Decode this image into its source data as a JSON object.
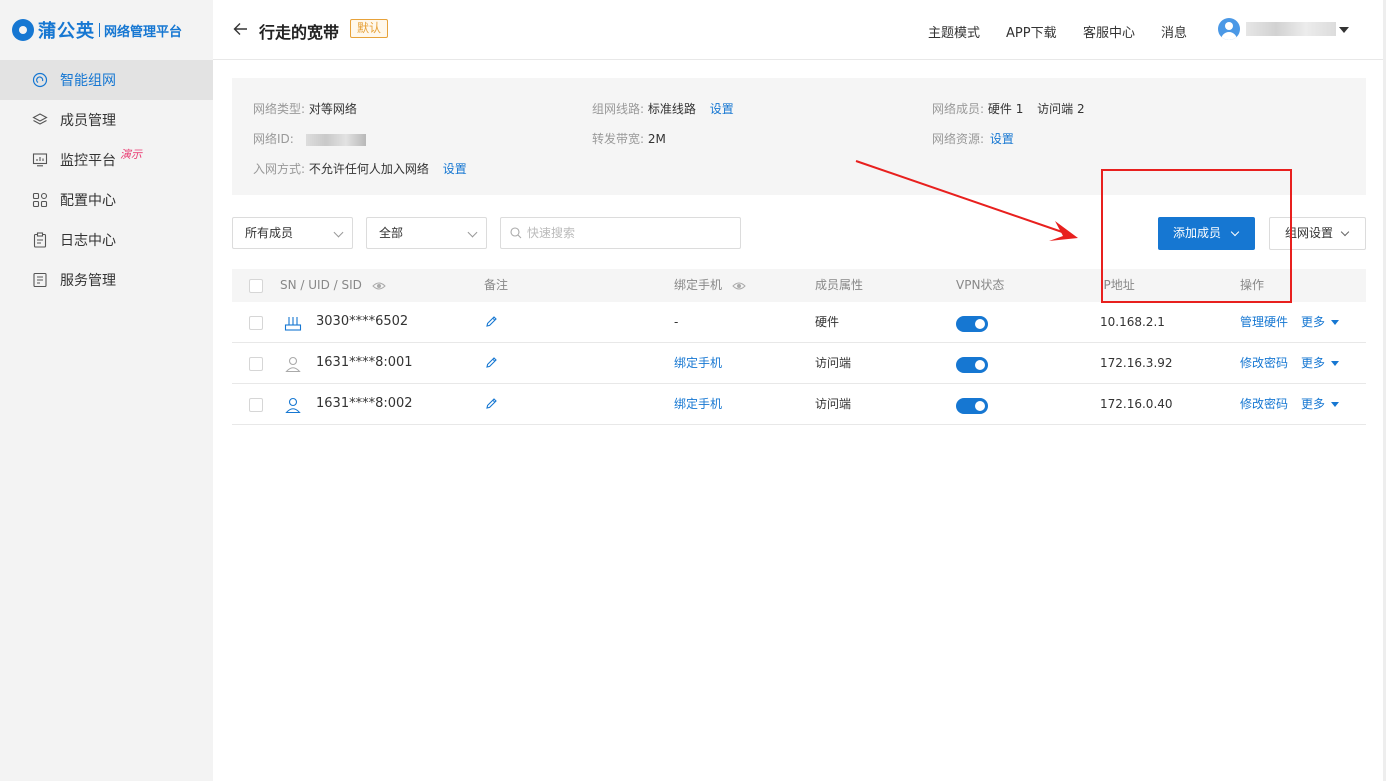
{
  "brand": {
    "name": "蒲公英",
    "subtitle": "网络管理平台"
  },
  "sidebar": {
    "items": [
      {
        "label": "智能组网",
        "icon": "smart-network-icon",
        "active": true
      },
      {
        "label": "成员管理",
        "icon": "layers-icon",
        "active": false
      },
      {
        "label": "监控平台",
        "icon": "monitor-icon",
        "active": false,
        "tag": "演示"
      },
      {
        "label": "配置中心",
        "icon": "grid-icon",
        "active": false
      },
      {
        "label": "日志中心",
        "icon": "clipboard-icon",
        "active": false
      },
      {
        "label": "服务管理",
        "icon": "document-icon",
        "active": false
      }
    ]
  },
  "header": {
    "title": "行走的宽带",
    "badge": "默认",
    "nav": [
      "主题模式",
      "APP下载",
      "客服中心",
      "消息"
    ]
  },
  "info": {
    "network_type_label": "网络类型:",
    "network_type_value": "对等网络",
    "route_label": "组网线路:",
    "route_value": "标准线路",
    "route_link": "设置",
    "members_label": "网络成员:",
    "members_hardware": "硬件 1",
    "members_access": "访问端 2",
    "network_id_label": "网络ID:",
    "bandwidth_label": "转发带宽:",
    "bandwidth_value": "2M",
    "resources_label": "网络资源:",
    "resources_link": "设置",
    "join_label": "入网方式:",
    "join_value": "不允许任何人加入网络",
    "join_link": "设置"
  },
  "filters": {
    "member_select": "所有成员",
    "status_select": "全部",
    "search_placeholder": "快速搜索",
    "add_button": "添加成员",
    "network_settings_button": "组网设置"
  },
  "table": {
    "headers": {
      "sn": "SN / UID / SID",
      "note": "备注",
      "phone": "绑定手机",
      "attr": "成员属性",
      "vpn": "VPN状态",
      "ip": "IP地址",
      "ops": "操作"
    },
    "rows": [
      {
        "icon": "router-icon",
        "sn": "3030****6502",
        "phone": "-",
        "attr": "硬件",
        "vpn": true,
        "ip": "10.168.2.1",
        "op1": "管理硬件",
        "op2": "更多"
      },
      {
        "icon": "user-gray-icon",
        "sn": "1631****8:001",
        "phone": "绑定手机",
        "attr": "访问端",
        "vpn": true,
        "ip": "172.16.3.92",
        "op1": "修改密码",
        "op2": "更多"
      },
      {
        "icon": "user-blue-icon",
        "sn": "1631****8:002",
        "phone": "绑定手机",
        "attr": "访问端",
        "vpn": true,
        "ip": "172.16.0.40",
        "op1": "修改密码",
        "op2": "更多"
      }
    ]
  },
  "colors": {
    "accent": "#1677d2",
    "badge": "#e7a23a",
    "annotation": "#e8201e",
    "tag": "#ea3b72"
  }
}
